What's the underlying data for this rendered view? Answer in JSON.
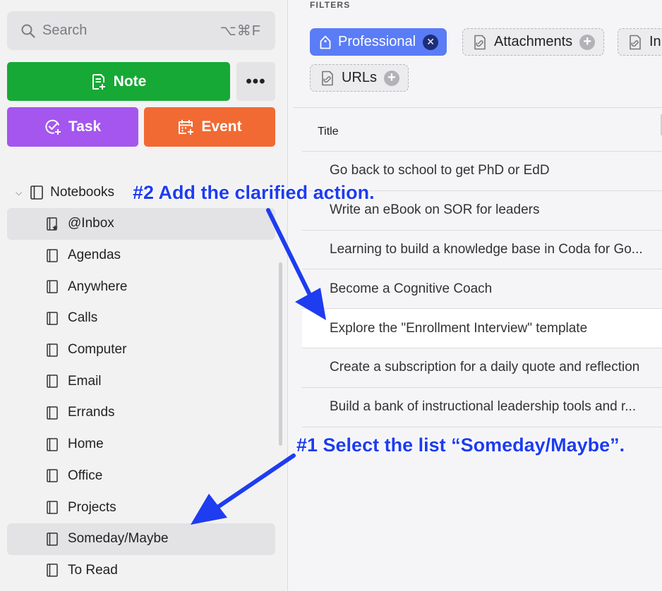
{
  "search": {
    "label": "Search",
    "shortcut": "⌥⌘F"
  },
  "actions": {
    "note_label": "Note",
    "more_label": "•••",
    "task_label": "Task",
    "event_label": "Event"
  },
  "notebooks": {
    "header": "Notebooks",
    "items": [
      {
        "label": "@Inbox"
      },
      {
        "label": "Agendas"
      },
      {
        "label": "Anywhere"
      },
      {
        "label": "Calls"
      },
      {
        "label": "Computer"
      },
      {
        "label": "Email"
      },
      {
        "label": "Errands"
      },
      {
        "label": "Home"
      },
      {
        "label": "Office"
      },
      {
        "label": "Projects"
      },
      {
        "label": "Someday/Maybe"
      },
      {
        "label": "To Read"
      }
    ]
  },
  "filters": {
    "heading": "FILTERS",
    "chips": [
      {
        "label": "Professional"
      },
      {
        "label": "Attachments"
      },
      {
        "label": "In"
      },
      {
        "label": "URLs"
      }
    ]
  },
  "table": {
    "column_title": "Title",
    "rows": [
      {
        "title": "Go back to school to get PhD or EdD"
      },
      {
        "title": "Write an eBook on SOR for leaders"
      },
      {
        "title": "Learning to build a knowledge base in Coda for Go..."
      },
      {
        "title": "Become a Cognitive Coach"
      },
      {
        "title": "Explore the \"Enrollment Interview\" template"
      },
      {
        "title": "Create a subscription for a daily quote and reflection"
      },
      {
        "title": "Build a bank of instructional leadership tools and r..."
      }
    ]
  },
  "annotations": {
    "step2": "#2 Add the clarified action.",
    "step1": "#1 Select the list “Someday/Maybe”."
  },
  "colors": {
    "note_green": "#16a935",
    "task_purple": "#a456ee",
    "event_orange": "#f16a33",
    "active_chip_blue": "#5a7cf6",
    "annotation_blue": "#1e3cf0"
  }
}
